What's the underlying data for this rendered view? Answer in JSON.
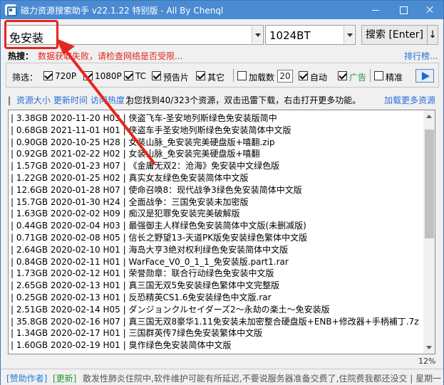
{
  "window": {
    "title": "磁力资源搜索助手 v22.1.22 特别版 - All By Chenql"
  },
  "search": {
    "keyword": "免安装",
    "site": "1024BT",
    "search_label": "搜索 [Enter]",
    "more_label": "↓"
  },
  "hot": {
    "label": "热搜：",
    "message": "数据获取失败，请检查网络是否受限...",
    "rank_link": "排行榜..."
  },
  "filters": {
    "label": "筛选：",
    "items": [
      {
        "label": "720P",
        "checked": true
      },
      {
        "label": "1080P",
        "checked": true
      },
      {
        "label": "TC",
        "checked": true
      },
      {
        "label": "预告片",
        "checked": true
      },
      {
        "label": "其它",
        "checked": true
      }
    ],
    "add_count_label": "加载数",
    "add_count_checked": false,
    "add_count_value": "20",
    "auto_label": "自动",
    "auto_checked": true,
    "ad_label": "广告",
    "ad_checked": true,
    "precise_label": "精准",
    "precise_checked": false
  },
  "info": {
    "sort_links": [
      "资源大小",
      "更新时间",
      "访问热度"
    ],
    "message": "为您找到40/323个资源，双击迅雷下载，右击打开更多功能。",
    "load_more": "加载更多资源"
  },
  "results": [
    "| 3.38GB 2020-11-20 H03 | 侠盗飞车-圣安地列斯绿色免安装版简中",
    "| 0.68GB 2021-11-01 H01 | 侠盗车手圣安地列斯绿色免安装简体中文版",
    "| 0.90GB 2020-10-25 H28 | 女装山脉_免安装完美硬盘版+嘻翻.zip",
    "| 0.92GB 2021-02-22 H02 | 女装山脉_免安装完美硬盘版+嘻翻",
    "| 1.57GB 2020-01-23 H07 | 《金庸无双2：沧海》免安装中文绿色版",
    "| 1.22GB 2020-01-25 H02 | 真实女友绿色免安装简体中文版",
    "| 12.6GB 2020-01-28 H07 | 使命召唤8：现代战争3绿色免安装简体中文版",
    "| 15.7GB 2020-01-30 H24 | 全面战争：三国免安装未加密版",
    "| 1.63GB 2020-02-02 H09 | 痴汉是犯罪免安装完美破解版",
    "| 0.44GB 2020-02-04 H03 | 最强御主人样绿色免安装简体中文版(未删减版)",
    "| 0.71GB 2020-02-08 H05 | 信长之野望13-天道PK版免安装绿色繁体中文版",
    "| 2.64GB 2020-02-10 H01 | 海岛大亨3绝对权利绿色免安装简体中文版",
    "| 0.84GB 2020-02-11 H01 | WarFace_V0_0_1_1_免安装版.part1.rar",
    "| 1.73GB 2020-02-12 H01 | 荣誉勋章：联合行动绿色免安装中文版",
    "| 2.65GB 2020-02-13 H01 | 真三国无双5免安装绿色繁体中文完整版",
    "| 0.25GB 2020-02-13 H01 | 反恐精英CS1.6免安装绿色中文版.rar",
    "| 2.51GB 2020-02-14 H05 | ダンジョンクルセイダーズ2～永劫の楽土～免安装版",
    "| 35.8GB 2020-02-16 H07 | 真三国无双8豪华1.11免安装未加密整合硬盘版+ENB+修改器+手柄補丁.7z",
    "| 1.34GB 2020-02-17 H01 | 三国群英传7绿色免安装繁体中文版",
    "| 1.60GB 2020-02-19 H01 | 臭作绿色免安装简体中文版"
  ],
  "scroll": {
    "percent_label": "12%"
  },
  "status": {
    "donate": "[赞助作者]",
    "update": "[更新]",
    "notice": "散发性肺炎住院中,软件维护可能有所延迟,不要说服务器准备交费了,住院费我都还没交 | 星期一"
  },
  "colors": {
    "title_bar": "#4a8bd2",
    "link": "#2a6fd6",
    "error": "#e0261d",
    "ad_green": "#1f9a2d",
    "highlight_red": "#e5261e"
  }
}
